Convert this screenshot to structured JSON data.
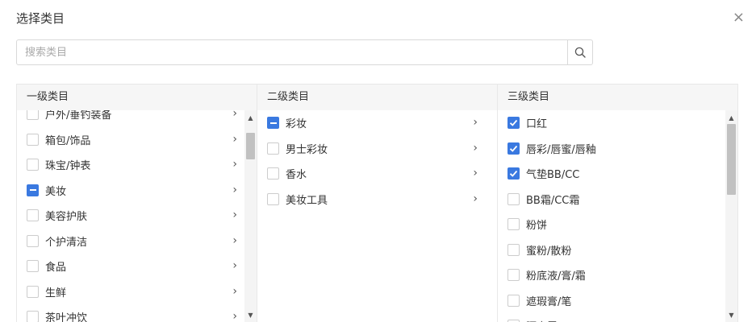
{
  "dialog": {
    "title": "选择类目",
    "close_icon": "×"
  },
  "search": {
    "placeholder": "搜索类目",
    "value": ""
  },
  "columns": [
    {
      "header": "一级类目",
      "items": [
        {
          "label": "户外/垂钓装备",
          "state": "unchecked",
          "has_children": true
        },
        {
          "label": "箱包/饰品",
          "state": "unchecked",
          "has_children": true
        },
        {
          "label": "珠宝/钟表",
          "state": "unchecked",
          "has_children": true
        },
        {
          "label": "美妆",
          "state": "partial",
          "has_children": true
        },
        {
          "label": "美容护肤",
          "state": "unchecked",
          "has_children": true
        },
        {
          "label": "个护清洁",
          "state": "unchecked",
          "has_children": true
        },
        {
          "label": "食品",
          "state": "unchecked",
          "has_children": true
        },
        {
          "label": "生鲜",
          "state": "unchecked",
          "has_children": true
        },
        {
          "label": "茶叶冲饮",
          "state": "unchecked",
          "has_children": true
        }
      ]
    },
    {
      "header": "二级类目",
      "items": [
        {
          "label": "彩妆",
          "state": "partial",
          "has_children": true
        },
        {
          "label": "男士彩妆",
          "state": "unchecked",
          "has_children": true
        },
        {
          "label": "香水",
          "state": "unchecked",
          "has_children": true
        },
        {
          "label": "美妆工具",
          "state": "unchecked",
          "has_children": true
        }
      ]
    },
    {
      "header": "三级类目",
      "items": [
        {
          "label": "口红",
          "state": "checked",
          "has_children": false
        },
        {
          "label": "唇彩/唇蜜/唇釉",
          "state": "checked",
          "has_children": false
        },
        {
          "label": "气垫BB/CC",
          "state": "checked",
          "has_children": false
        },
        {
          "label": "BB霜/CC霜",
          "state": "unchecked",
          "has_children": false
        },
        {
          "label": "粉饼",
          "state": "unchecked",
          "has_children": false
        },
        {
          "label": "蜜粉/散粉",
          "state": "unchecked",
          "has_children": false
        },
        {
          "label": "粉底液/膏/霜",
          "state": "unchecked",
          "has_children": false
        },
        {
          "label": "遮瑕膏/笔",
          "state": "unchecked",
          "has_children": false
        },
        {
          "label": "隔离霜",
          "state": "unchecked",
          "has_children": false
        }
      ]
    }
  ],
  "icons": {
    "arrow": "›",
    "scroll_up": "▲",
    "scroll_down": "▼"
  },
  "colors": {
    "accent": "#3a79e0",
    "border": "#e8e8e8",
    "header_bg": "#f6f6f6"
  }
}
